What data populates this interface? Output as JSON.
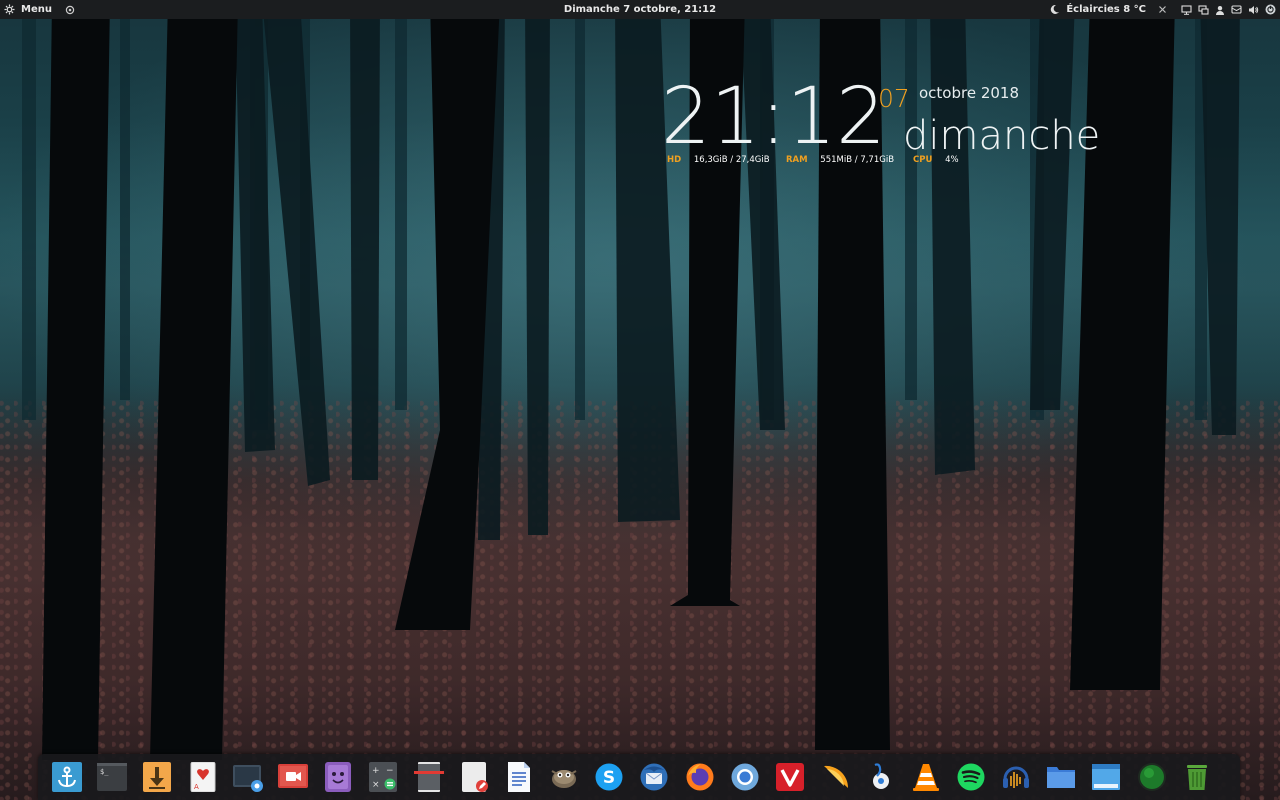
{
  "top_panel": {
    "menu_label": "Menu",
    "datetime": "Dimanche  7 octobre, 21:12",
    "weather": "Éclaircies 8 °C",
    "icons": [
      "menu-icon",
      "screenshot-icon",
      "weather-night-icon",
      "close-icon",
      "display-icon",
      "network-icon",
      "user-icon",
      "mail-icon",
      "volume-icon",
      "power-icon"
    ]
  },
  "conky": {
    "time": "21:12",
    "day_number": "07",
    "month_year": "octobre 2018",
    "weekday": "dimanche",
    "hd_label": "HD",
    "hd_value": "16,3GiB / 27,4GiB",
    "ram_label": "RAM",
    "ram_value": "551MiB / 7,71GiB",
    "cpu_label": "CPU",
    "cpu_value": "4%",
    "accent_color": "#f0a020"
  },
  "dock": {
    "items": [
      "anchor-icon",
      "terminal-icon",
      "download-icon",
      "solitaire-icon",
      "screenshot-icon",
      "screen-recorder-icon",
      "face-app-icon",
      "calculator-icon",
      "document-scanner-icon",
      "text-editor-icon",
      "writer-icon",
      "gimp-icon",
      "skype-icon",
      "thunderbird-icon",
      "firefox-icon",
      "chromium-icon",
      "vivaldi-icon",
      "orange-slice-icon",
      "gnome-maps-icon",
      "vlc-icon",
      "spotify-icon",
      "audacity-icon",
      "folder-icon",
      "window-icon",
      "green-orb-icon",
      "trash-icon"
    ]
  }
}
